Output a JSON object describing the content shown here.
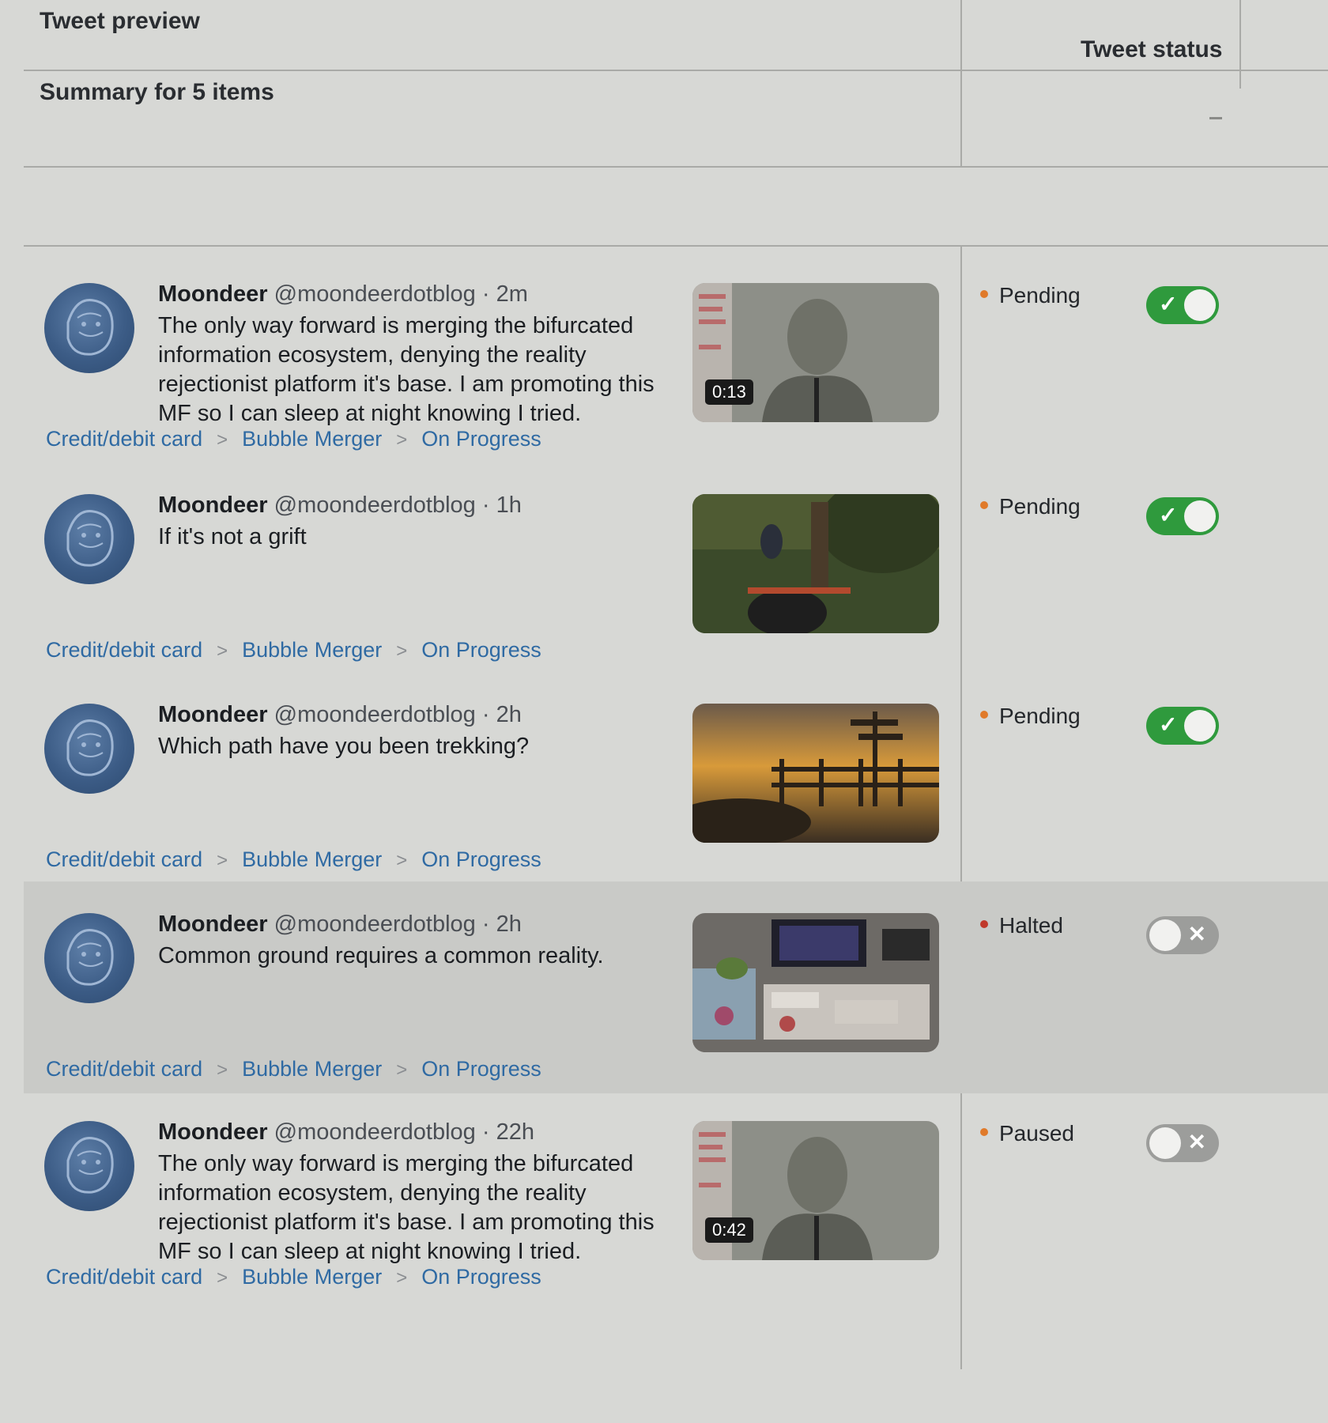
{
  "header": {
    "tweet_preview": "Tweet preview",
    "tweet_status": "Tweet status"
  },
  "summary": {
    "label": "Summary for 5 items",
    "status_value": "–"
  },
  "colors": {
    "pending": "#e07a2a",
    "halted": "#c0392b",
    "paused": "#e07a2a",
    "toggle_on": "#2f9a3d",
    "link": "#2f6aa3"
  },
  "rows": [
    {
      "author": "Moondeer",
      "handle": "@moondeerdotblog",
      "time": "· 2m",
      "text": "The only way forward is merging the bifurcated information ecosystem, denying the reality rejectionist platform it's base. I am promoting this MF so I can sleep at night knowing I tried.",
      "media": {
        "kind": "video-portrait",
        "duration": "0:13"
      },
      "crumbs": [
        "Credit/debit card",
        "Bubble Merger",
        "On Progress"
      ],
      "status": "Pending",
      "toggle": "on",
      "toggle_glyph": "✓"
    },
    {
      "author": "Moondeer",
      "handle": "@moondeerdotblog",
      "time": "· 1h",
      "text": "If it's not a grift",
      "media": {
        "kind": "image-game"
      },
      "crumbs": [
        "Credit/debit card",
        "Bubble Merger",
        "On Progress"
      ],
      "status": "Pending",
      "toggle": "on",
      "toggle_glyph": "✓"
    },
    {
      "author": "Moondeer",
      "handle": "@moondeerdotblog",
      "time": "· 2h",
      "text": "Which path have you been trekking?",
      "media": {
        "kind": "image-sunset"
      },
      "crumbs": [
        "Credit/debit card",
        "Bubble Merger",
        "On Progress"
      ],
      "status": "Pending",
      "toggle": "on",
      "toggle_glyph": "✓"
    },
    {
      "author": "Moondeer",
      "handle": "@moondeerdotblog",
      "time": "· 2h",
      "text": "Common ground requires a common reality.",
      "media": {
        "kind": "image-room"
      },
      "crumbs": [
        "Credit/debit card",
        "Bubble Merger",
        "On Progress"
      ],
      "status": "Halted",
      "toggle": "off",
      "toggle_glyph": "✕"
    },
    {
      "author": "Moondeer",
      "handle": "@moondeerdotblog",
      "time": "· 22h",
      "text": "The only way forward is merging the bifurcated information ecosystem, denying the reality rejectionist platform it's base. I am promoting this MF so I can sleep at night knowing I tried.",
      "media": {
        "kind": "video-portrait",
        "duration": "0:42"
      },
      "crumbs": [
        "Credit/debit card",
        "Bubble Merger",
        "On Progress"
      ],
      "status": "Paused",
      "toggle": "off",
      "toggle_glyph": "✕"
    }
  ]
}
